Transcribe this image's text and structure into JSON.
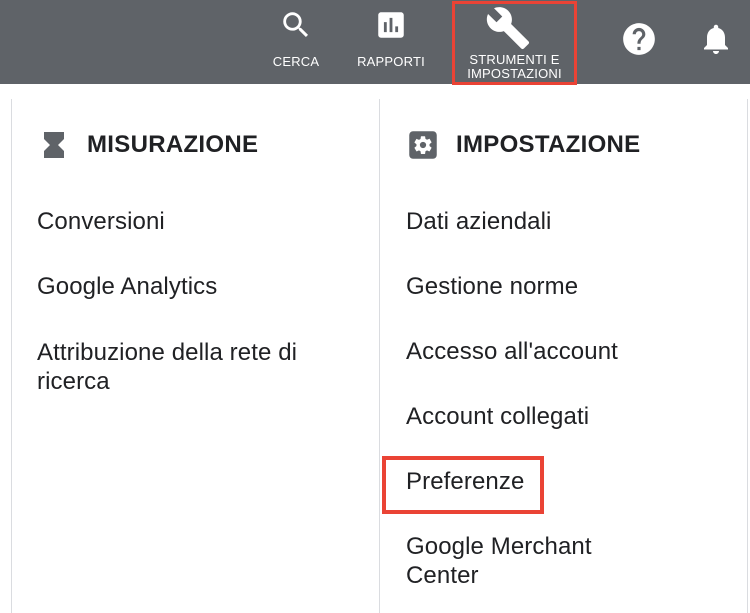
{
  "header": {
    "search_label": "CERCA",
    "reports_label": "RAPPORTI",
    "tools_label_line1": "STRUMENTI E",
    "tools_label_line2": "IMPOSTAZIONI",
    "icons": {
      "search": "search-icon",
      "reports": "bar-chart-icon",
      "tools": "wrench-icon",
      "help": "help-icon",
      "notifications": "bell-icon"
    }
  },
  "measurement": {
    "title": "MISURAZIONE",
    "icon": "hourglass-icon",
    "items": [
      "Conversioni",
      "Google Analytics",
      "Attribuzione della rete di ricerca"
    ]
  },
  "setup": {
    "title": "IMPOSTAZIONE",
    "icon": "gear-icon",
    "items": [
      "Dati aziendali",
      "Gestione norme",
      "Accesso all'account",
      "Account collegati",
      "Preferenze",
      "Google Merchant Center"
    ]
  },
  "colors": {
    "topbar": "#5f6368",
    "highlight": "#ea4335",
    "text": "#202124",
    "divider": "#dadce0"
  }
}
